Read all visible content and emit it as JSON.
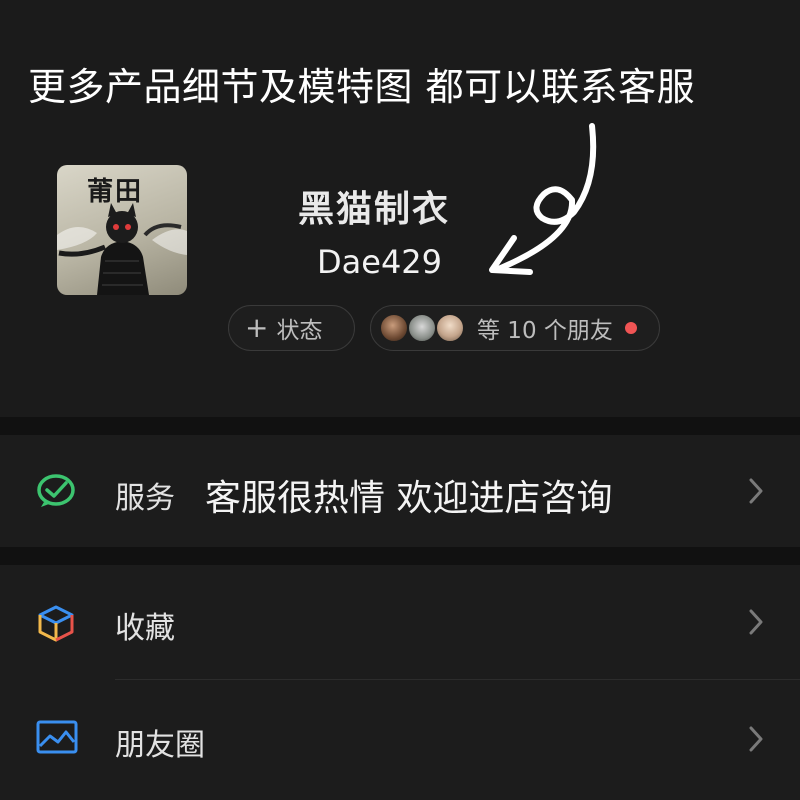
{
  "overlay": {
    "caption": "更多产品细节及模特图 都可以联系客服"
  },
  "profile": {
    "avatar_text": "莆田",
    "name": "黑猫制衣",
    "wechat_id": "Dae429",
    "status_button": {
      "icon": "plus-icon",
      "label": "状态"
    },
    "friends_pill": {
      "label": "等 10 个朋友",
      "dot_color": "#f05454"
    }
  },
  "menu": {
    "service": {
      "label": "服务",
      "promo": "客服很热情 欢迎进店咨询",
      "icon": "wechat-pay-icon"
    },
    "favorites": {
      "label": "收藏",
      "icon": "cube-icon"
    },
    "moments": {
      "label": "朋友圈",
      "icon": "picture-icon"
    }
  },
  "colors": {
    "service_icon": "#3cc46f",
    "moments_icon": "#3a8ff0",
    "background": "#1a1a1a"
  }
}
